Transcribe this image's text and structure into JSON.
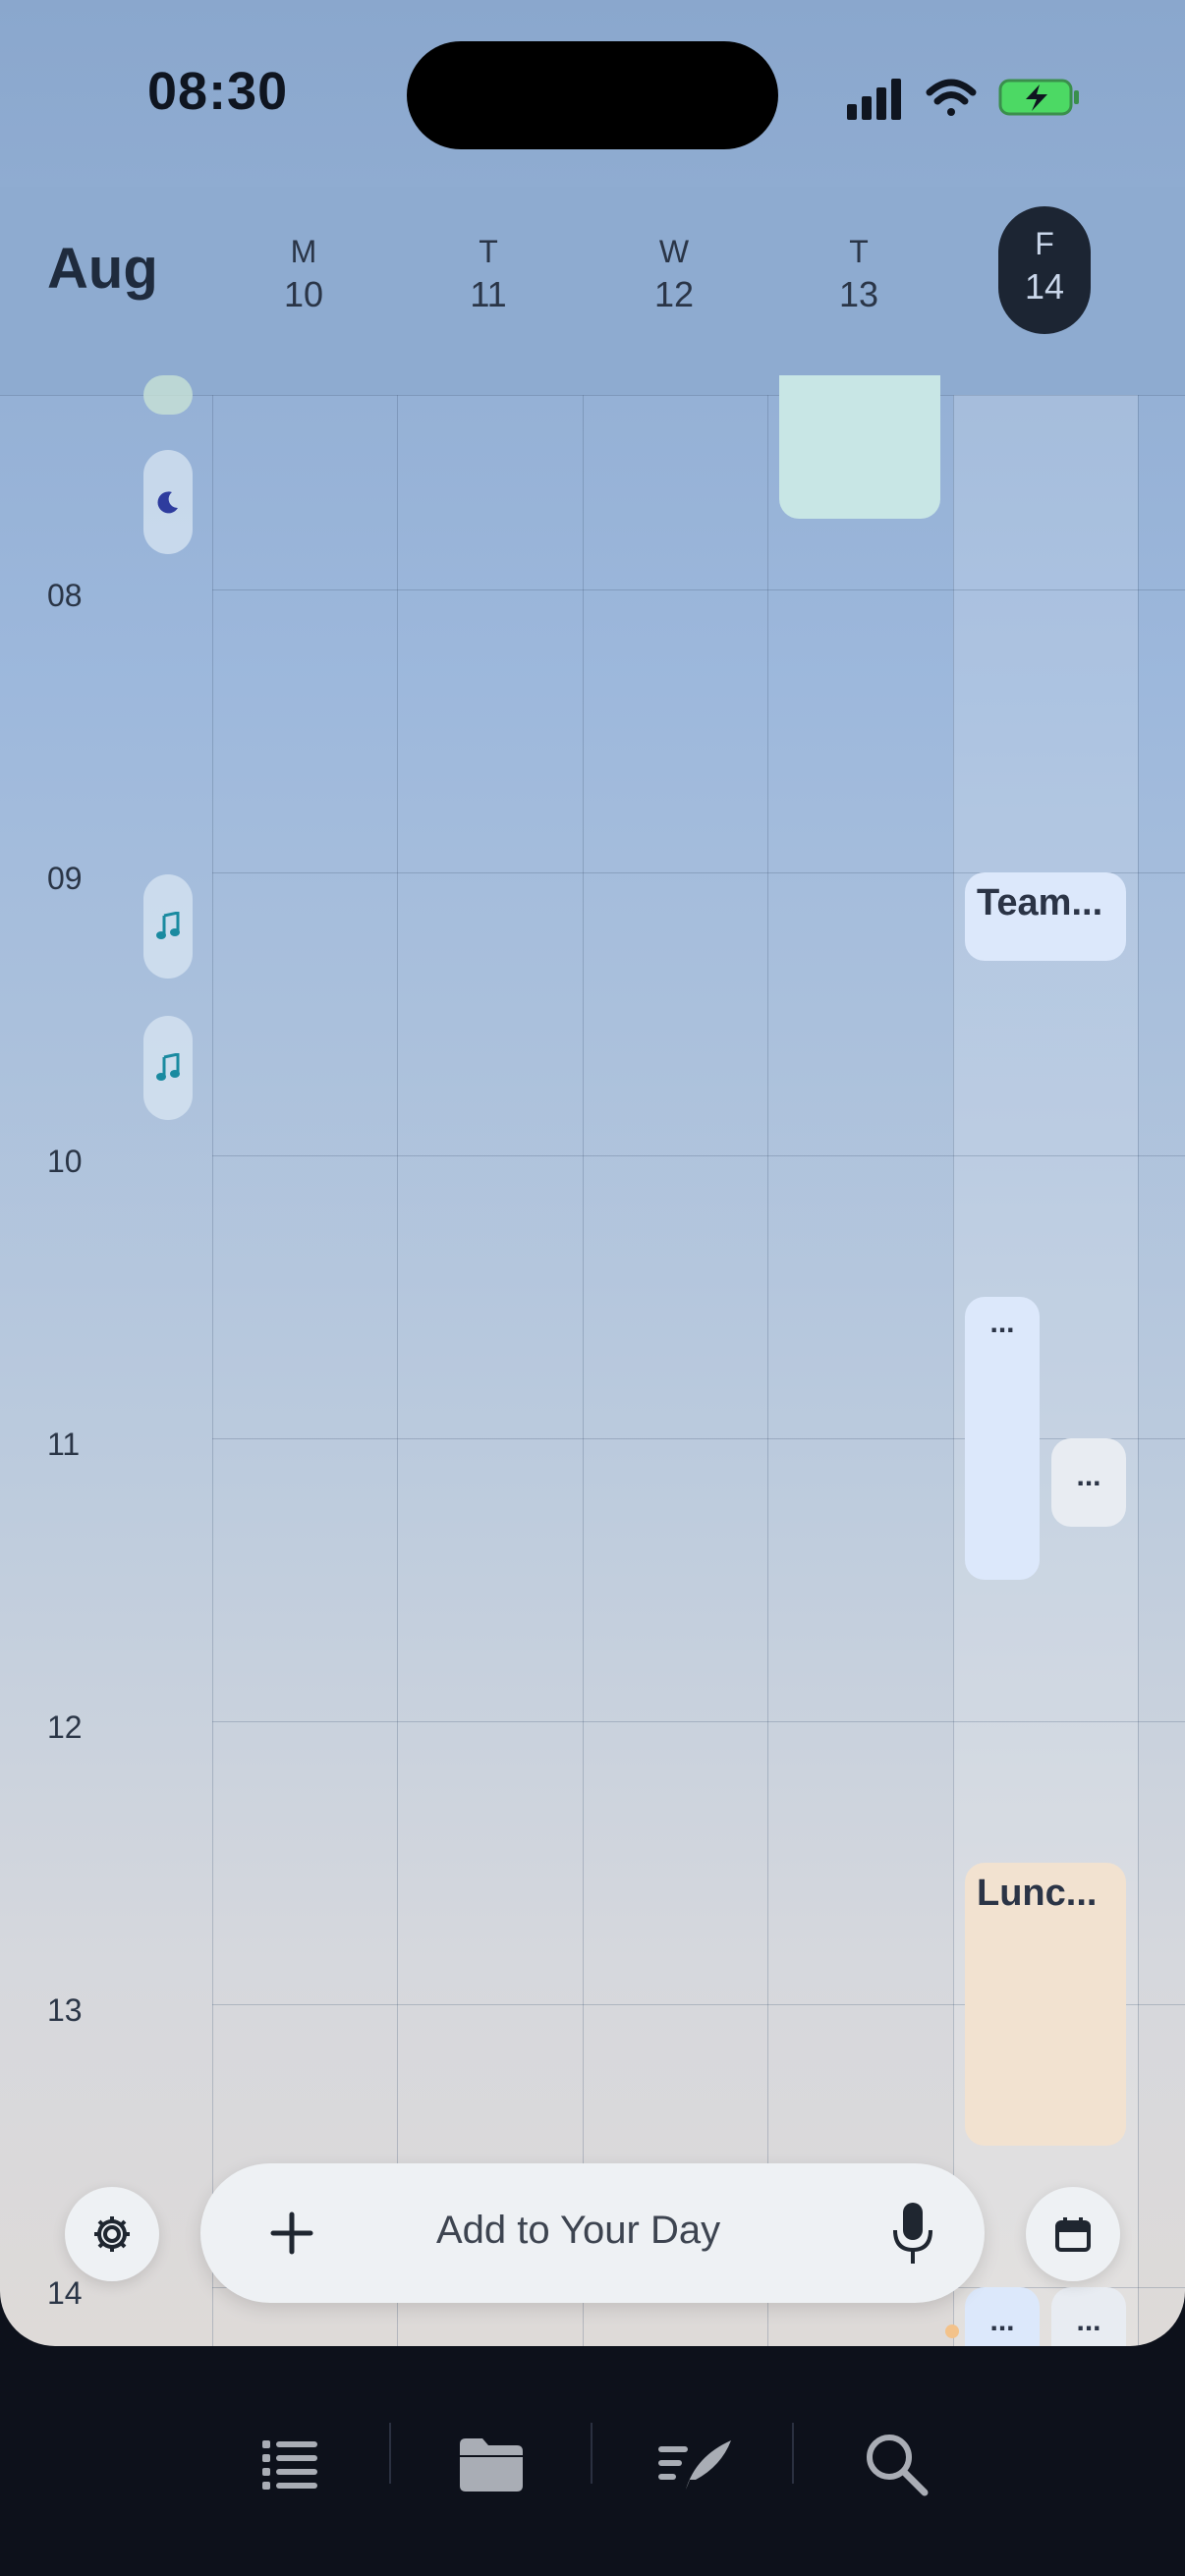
{
  "status_bar": {
    "time": "08:30"
  },
  "header": {
    "month": "Aug",
    "days": [
      {
        "letter": "M",
        "number": "10"
      },
      {
        "letter": "T",
        "number": "11"
      },
      {
        "letter": "W",
        "number": "12"
      },
      {
        "letter": "T",
        "number": "13"
      },
      {
        "letter": "F",
        "number": "14",
        "selected": true
      }
    ]
  },
  "timeline": {
    "hours": [
      "08",
      "09",
      "10",
      "11",
      "12",
      "13",
      "14"
    ]
  },
  "events": {
    "team": {
      "title": "Team..."
    },
    "lunch": {
      "title": "Lunc..."
    },
    "more1": {
      "label": "..."
    },
    "more2": {
      "label": "..."
    },
    "more3": {
      "label": "..."
    },
    "more4": {
      "label": "..."
    }
  },
  "add_bar": {
    "placeholder": "Add to Your Day"
  },
  "icons": {
    "status": [
      "signal-icon",
      "wifi-icon",
      "battery-icon"
    ],
    "sidebar": [
      "moon-icon",
      "music-note-icon"
    ],
    "controls": [
      "gear-icon",
      "plus-icon",
      "microphone-icon",
      "calendar-icon"
    ],
    "tabs": [
      "list-icon",
      "folder-icon",
      "feather-icon",
      "search-icon"
    ]
  },
  "colors": {
    "accent_dark": "#1c2533",
    "event_blue": "#dce8fb",
    "event_peach": "#f2e2d0",
    "event_mint": "#c8e6e5",
    "battery_green": "#4cd964"
  }
}
